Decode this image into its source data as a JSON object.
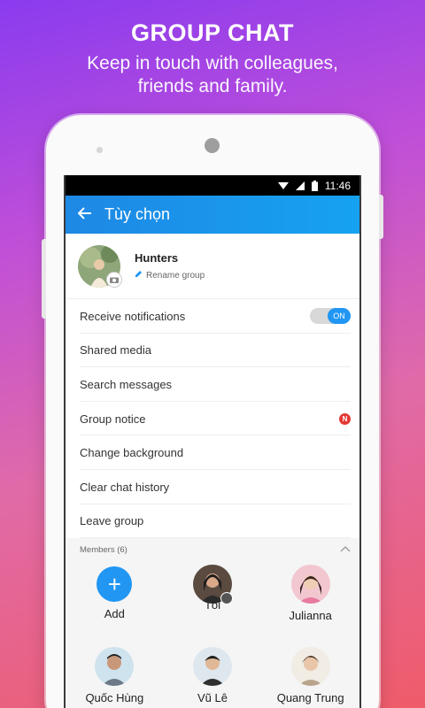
{
  "promo": {
    "title": "GROUP CHAT",
    "subtitle_line1": "Keep in touch with colleagues,",
    "subtitle_line2": "friends and family."
  },
  "status_bar": {
    "time": "11:46"
  },
  "app_bar": {
    "title": "Tùy chọn",
    "back_icon": "arrow-back-icon"
  },
  "group": {
    "name": "Hunters",
    "rename_label": "Rename group"
  },
  "menu": [
    {
      "label": "Receive notifications",
      "toggle": "ON"
    },
    {
      "label": "Shared media"
    },
    {
      "label": "Search messages"
    },
    {
      "label": "Group notice",
      "badge": "N"
    },
    {
      "label": "Change background"
    },
    {
      "label": "Clear chat history"
    },
    {
      "label": "Leave group"
    }
  ],
  "members": {
    "header": "Members (6)",
    "add_label": "Add",
    "list": [
      {
        "name": "Tôi"
      },
      {
        "name": "Julianna"
      },
      {
        "name": "Quốc Hùng"
      },
      {
        "name": "Vũ Lê"
      },
      {
        "name": "Quang Trung"
      }
    ]
  },
  "colors": {
    "accent": "#2196f3",
    "badge": "#e53935"
  }
}
